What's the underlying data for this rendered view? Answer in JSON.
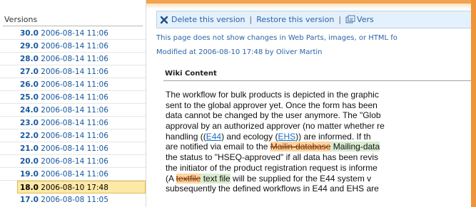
{
  "versions": {
    "header": "Versions",
    "items": [
      {
        "num": "30.0",
        "date": "2006-08-14 11:06"
      },
      {
        "num": "29.0",
        "date": "2006-08-14 11:06"
      },
      {
        "num": "28.0",
        "date": "2006-08-14 11:06"
      },
      {
        "num": "27.0",
        "date": "2006-08-14 11:06"
      },
      {
        "num": "26.0",
        "date": "2006-08-14 11:06"
      },
      {
        "num": "25.0",
        "date": "2006-08-14 11:06"
      },
      {
        "num": "24.0",
        "date": "2006-08-14 11:06"
      },
      {
        "num": "23.0",
        "date": "2006-08-14 11:06"
      },
      {
        "num": "22.0",
        "date": "2006-08-14 11:06"
      },
      {
        "num": "21.0",
        "date": "2006-08-14 11:06"
      },
      {
        "num": "20.0",
        "date": "2006-08-14 11:06"
      },
      {
        "num": "19.0",
        "date": "2006-08-14 11:06"
      },
      {
        "num": "18.0",
        "date": "2006-08-10 17:48"
      },
      {
        "num": "17.0",
        "date": "2006-08-08 11:05"
      }
    ]
  },
  "toolbar": {
    "delete_label": "Delete this version",
    "separator": "|",
    "restore_label": "Restore this version",
    "versions_label": "Vers"
  },
  "info": {
    "notice": "This page does not show changes in Web Parts, images, or HTML fo",
    "modified": "Modified at 2006-08-10 17:48  by Oliver Martin"
  },
  "wiki": {
    "title": "Wiki Content",
    "lines": [
      [
        "The workflow for bulk products is depicted in the graphic"
      ],
      [
        "sent to the global approver yet. Once the form has been"
      ],
      [
        "data cannot be changed by the user anymore. The \"Glob"
      ],
      [
        "approval by an authorized approver (no matter whether re"
      ],
      [
        "handling ((",
        "E44",
        ") and ecology (",
        "EHS",
        ")) are informed. If th"
      ],
      [
        "are notified via email to the ",
        "Mailin-database",
        " Mailing-data"
      ],
      [
        "the status to \"HSEQ-approved\" if all data has been revis"
      ],
      [
        "the initiator of the product registration request is informe"
      ],
      [
        "(A ",
        "textfile",
        " text file",
        " will be supplied for the E44 system v"
      ],
      [
        "subsequently the defined workflows in E44 and EHS are"
      ]
    ]
  },
  "colors": {
    "accent_orange": "#f0943a",
    "link_blue": "#1858a0",
    "selected_bg": "#fde9a6",
    "deleted_bg": "#fbd6a2",
    "added_bg": "#d9ecd0"
  }
}
